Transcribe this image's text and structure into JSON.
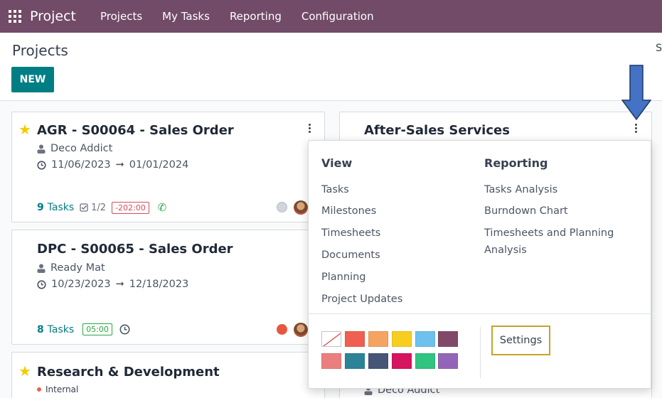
{
  "navbar": {
    "brand": "Project",
    "items": [
      "Projects",
      "My Tasks",
      "Reporting",
      "Configuration"
    ]
  },
  "control_panel": {
    "title": "Projects",
    "new_label": "NEW",
    "right_clip": "S"
  },
  "cards": [
    {
      "title": "AGR - S00064 - Sales Order",
      "starred": true,
      "customer": "Deco Addict",
      "date_start": "11/06/2023",
      "date_end": "01/01/2024",
      "tasks_count": "9",
      "tasks_label": "Tasks",
      "subtasks": "1/2",
      "time_badge": "-202:00",
      "status_color": "#d1d5db"
    },
    {
      "title": "DPC - S00065 - Sales Order",
      "starred": false,
      "customer": "Ready Mat",
      "date_start": "10/23/2023",
      "date_end": "12/18/2023",
      "tasks_count": "8",
      "tasks_label": "Tasks",
      "time_badge": "05:00",
      "status_color": "#e8573d"
    },
    {
      "title": "Research & Development",
      "starred": true,
      "tag": "Internal"
    },
    {
      "title": "After-Sales Services",
      "customer": "Deco Addict"
    }
  ],
  "dropdown": {
    "view_heading": "View",
    "view_items": [
      "Tasks",
      "Milestones",
      "Timesheets",
      "Documents",
      "Planning",
      "Project Updates"
    ],
    "reporting_heading": "Reporting",
    "reporting_items": [
      "Tasks Analysis",
      "Burndown Chart",
      "Timesheets and Planning",
      "Analysis"
    ],
    "settings_label": "Settings",
    "colors": [
      "none",
      "#f06050",
      "#f4a460",
      "#f7cd1f",
      "#6cc1ed",
      "#814968",
      "#eb7e7f",
      "#2c8397",
      "#475577",
      "#d6145f",
      "#30c381",
      "#9365b8"
    ]
  },
  "colors": {
    "navbar": "#714b67",
    "primary": "#017e84",
    "arrow": "#4472c4",
    "star": "#f3cc00"
  }
}
